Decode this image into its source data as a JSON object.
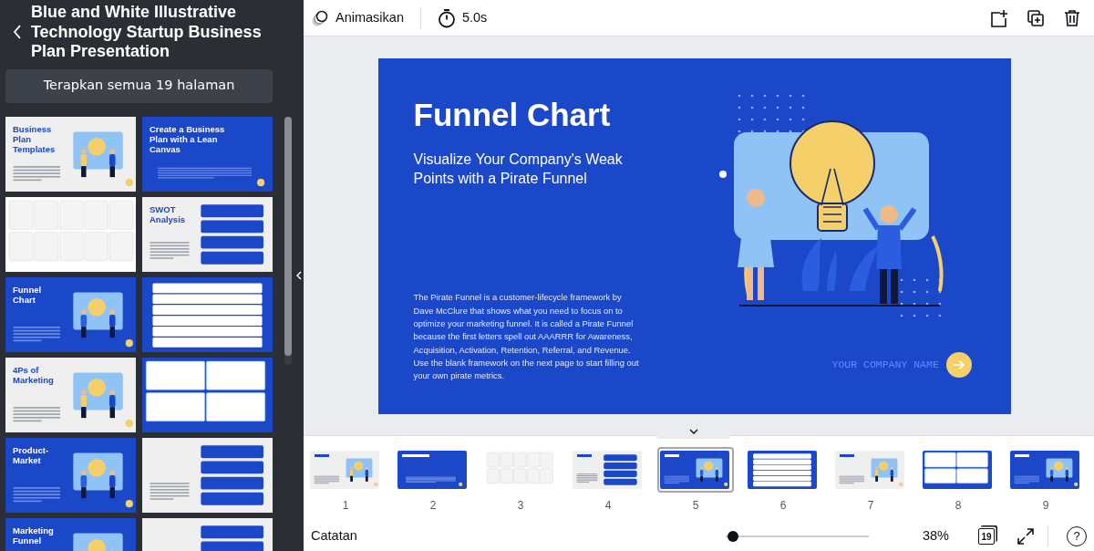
{
  "sidebar": {
    "title": "Blue and White Illustrative Technology Startup Business Plan Presentation",
    "apply_button": "Terapkan semua 19 halaman",
    "templates": [
      {
        "color": "#efefef",
        "kind": "illustrated",
        "title": "Business Plan Templates"
      },
      {
        "color": "#1b47c9",
        "kind": "text",
        "title": "Create a Business Plan with a Lean Canvas"
      },
      {
        "color": "#ffffff",
        "kind": "grid"
      },
      {
        "color": "#efefef",
        "kind": "cards",
        "title": "SWOT Analysis"
      },
      {
        "color": "#1b47c9",
        "kind": "illustrated",
        "title": "Funnel Chart"
      },
      {
        "color": "#1b47c9",
        "kind": "table"
      },
      {
        "color": "#efefef",
        "kind": "illustrated",
        "title": "4Ps of Marketing"
      },
      {
        "color": "#1b47c9",
        "kind": "grid"
      },
      {
        "color": "#1b47c9",
        "kind": "illustrated",
        "title": "Product-Market"
      },
      {
        "color": "#efefef",
        "kind": "cards"
      },
      {
        "color": "#1b47c9",
        "kind": "illustrated",
        "title": "Marketing Funnel"
      },
      {
        "color": "#efefef",
        "kind": "cards"
      }
    ]
  },
  "toolbar": {
    "animate": "Animasikan",
    "duration": "5.0s"
  },
  "slide": {
    "title": "Funnel Chart",
    "subtitle": "Visualize Your Company's Weak Points with a Pirate Funnel",
    "body": "The Pirate Funnel is a customer-lifecycle framework by Dave McClure that shows what you need to focus on to optimize your marketing funnel. It is called a Pirate Funnel because the first letters spell out AAARRR for Awareness, Acquisition, Activation, Retention, Referral, and Revenue. Use the blank framework on the next page to start filling out your own pirate metrics.",
    "company": "YOUR COMPANY NAME"
  },
  "pages": [
    {
      "number": "1",
      "color": "#efefef",
      "kind": "illustrated",
      "selected": false
    },
    {
      "number": "2",
      "color": "#1b47c9",
      "kind": "text",
      "selected": false
    },
    {
      "number": "3",
      "color": "#ffffff",
      "kind": "grid",
      "selected": false
    },
    {
      "number": "4",
      "color": "#efefef",
      "kind": "cards",
      "selected": false
    },
    {
      "number": "5",
      "color": "#1b47c9",
      "kind": "illustrated",
      "selected": true
    },
    {
      "number": "6",
      "color": "#1b47c9",
      "kind": "table",
      "selected": false
    },
    {
      "number": "7",
      "color": "#efefef",
      "kind": "illustrated",
      "selected": false
    },
    {
      "number": "8",
      "color": "#1b47c9",
      "kind": "grid",
      "selected": false
    },
    {
      "number": "9",
      "color": "#1b47c9",
      "kind": "illustrated",
      "selected": false
    }
  ],
  "footer": {
    "notes": "Catatan",
    "zoom": {
      "level": 0.05
    },
    "zoom_text": "38%",
    "page_count": "19",
    "help": "?"
  }
}
